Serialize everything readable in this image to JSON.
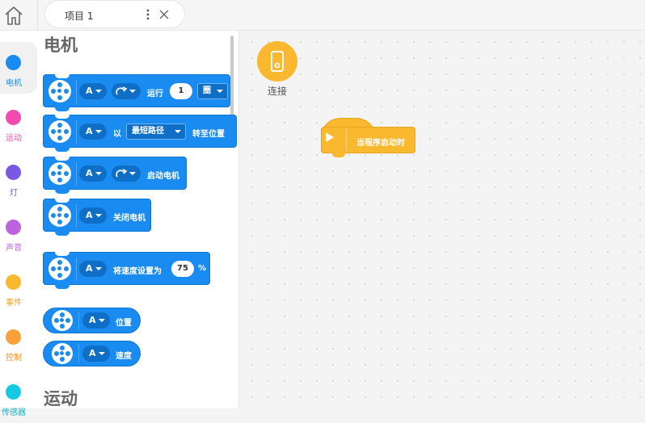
{
  "tab": {
    "label": "项目 1"
  },
  "categories": [
    {
      "label": "电机",
      "color": "#1a8bf1"
    },
    {
      "label": "运动",
      "color": "#f24bb0"
    },
    {
      "label": "灯",
      "color": "#7b57e6"
    },
    {
      "label": "声音",
      "color": "#bd62e0"
    },
    {
      "label": "事件",
      "color": "#f9b82e"
    },
    {
      "label": "控制",
      "color": "#f9a03a"
    },
    {
      "label": "传感器",
      "color": "#16c9e3"
    }
  ],
  "palette": {
    "section_motor": "电机",
    "section_motion": "运动",
    "blocks": {
      "run": {
        "port": "A",
        "label": "运行",
        "value": "1",
        "unit": "圈"
      },
      "goto": {
        "port": "A",
        "prefix": "以",
        "mode": "最短路径",
        "label": "转至位置"
      },
      "start": {
        "port": "A",
        "label": "启动电机"
      },
      "stop": {
        "port": "A",
        "label": "关闭电机"
      },
      "speed": {
        "port": "A",
        "label": "将速度设置为",
        "value": "75",
        "unit": "%"
      },
      "position": {
        "port": "A",
        "label": "位置"
      },
      "speed_reporter": {
        "port": "A",
        "label": "速度"
      }
    }
  },
  "canvas": {
    "connect_label": "连接",
    "hat_label": "当程序启动时"
  },
  "icons": {
    "home": "home-icon",
    "more": "more-vertical-icon",
    "close": "close-icon",
    "motor": "motor-icon",
    "direction": "clockwise-arrow-icon",
    "device": "hub-device-icon",
    "play": "play-icon"
  }
}
